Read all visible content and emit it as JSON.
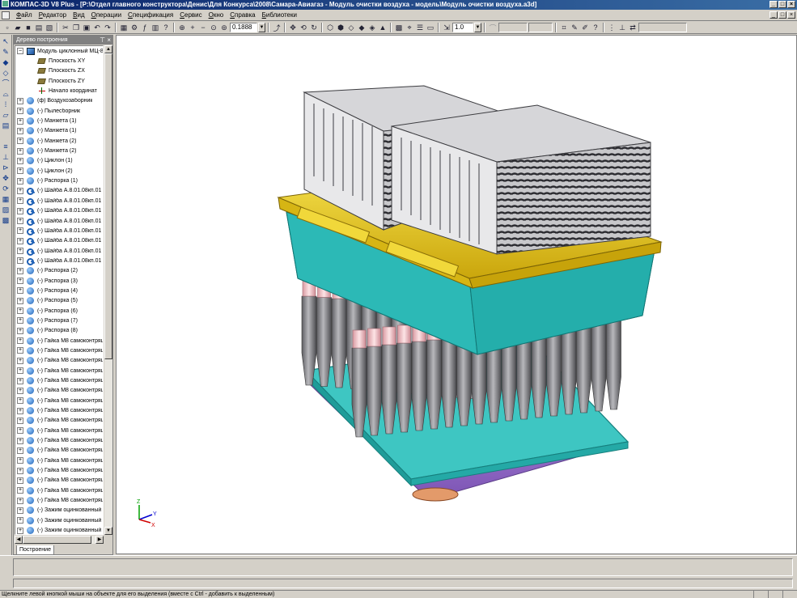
{
  "window": {
    "title": "КОМПАС-3D V8 Plus - [P:\\Отдел главного конструктора\\Денис\\Для Конкурса\\2008\\Самара-Авиагаз - Модуль очистки воздуха - модель\\Модуль очистки воздуха.a3d]"
  },
  "menu": {
    "items": [
      "Файл",
      "Редактор",
      "Вид",
      "Операции",
      "Спецификация",
      "Сервис",
      "Окно",
      "Справка",
      "Библиотеки"
    ]
  },
  "toolbar": {
    "zoom_value": "0.1888",
    "step_value": "1.0"
  },
  "panel": {
    "title": "Дерево построения",
    "tab_label": "Построение"
  },
  "tree": {
    "root": "Модуль циклонный МЦ-88",
    "items": [
      {
        "icon": "plane",
        "indent": 1,
        "label": "Плоскость XY"
      },
      {
        "icon": "plane",
        "indent": 1,
        "label": "Плоскость ZX"
      },
      {
        "icon": "plane",
        "indent": 1,
        "label": "Плоскость ZY"
      },
      {
        "icon": "origin",
        "indent": 1,
        "label": "Начало координат"
      },
      {
        "icon": "part",
        "expander": true,
        "label": "(ф) Воздухозаборник"
      },
      {
        "icon": "part",
        "expander": true,
        "label": "(-) Пылесборник"
      },
      {
        "icon": "part",
        "expander": true,
        "label": "(-) Манжета (1)"
      },
      {
        "icon": "part",
        "expander": true,
        "label": "(-) Манжета (1)"
      },
      {
        "icon": "part",
        "expander": true,
        "label": "(-) Манжета (2)"
      },
      {
        "icon": "part",
        "expander": true,
        "label": "(-) Манжета (2)"
      },
      {
        "icon": "part",
        "expander": true,
        "label": "(-) Циклон (1)"
      },
      {
        "icon": "part",
        "expander": true,
        "label": "(-) Циклон (2)"
      },
      {
        "icon": "part",
        "expander": true,
        "label": "(-) Распорка (1)"
      },
      {
        "icon": "key",
        "expander": true,
        "label": "(-) Шайба А.8.01.08кп.01"
      },
      {
        "icon": "key",
        "expander": true,
        "label": "(-) Шайба А.8.01.08кп.01"
      },
      {
        "icon": "key",
        "expander": true,
        "label": "(-) Шайба А.8.01.08кп.01"
      },
      {
        "icon": "key",
        "expander": true,
        "label": "(-) Шайба А.8.01.08кп.01"
      },
      {
        "icon": "key",
        "expander": true,
        "label": "(-) Шайба А.8.01.08кп.01"
      },
      {
        "icon": "key",
        "expander": true,
        "label": "(-) Шайба А.8.01.08кп.01"
      },
      {
        "icon": "key",
        "expander": true,
        "label": "(-) Шайба А.8.01.08кп.01"
      },
      {
        "icon": "key",
        "expander": true,
        "label": "(-) Шайба А.8.01.08кп.01"
      },
      {
        "icon": "part",
        "expander": true,
        "label": "(-) Распорка (2)"
      },
      {
        "icon": "part",
        "expander": true,
        "label": "(-) Распорка (3)"
      },
      {
        "icon": "part",
        "expander": true,
        "label": "(-) Распорка (4)"
      },
      {
        "icon": "part",
        "expander": true,
        "label": "(-) Распорка (5)"
      },
      {
        "icon": "part",
        "expander": true,
        "label": "(-) Распорка (6)"
      },
      {
        "icon": "part",
        "expander": true,
        "label": "(-) Распорка (7)"
      },
      {
        "icon": "part",
        "expander": true,
        "label": "(-) Распорка (8)"
      },
      {
        "icon": "part",
        "expander": true,
        "label": "(-) Гайка М8 самоконтрящ"
      },
      {
        "icon": "part",
        "expander": true,
        "label": "(-) Гайка М8 самоконтрящ"
      },
      {
        "icon": "part",
        "expander": true,
        "label": "(-) Гайка М8 самоконтрящ"
      },
      {
        "icon": "part",
        "expander": true,
        "label": "(-) Гайка М8 самоконтрящ"
      },
      {
        "icon": "part",
        "expander": true,
        "label": "(-) Гайка М8 самоконтрящ"
      },
      {
        "icon": "part",
        "expander": true,
        "label": "(-) Гайка М8 самоконтрящ"
      },
      {
        "icon": "part",
        "expander": true,
        "label": "(-) Гайка М8 самоконтрящ"
      },
      {
        "icon": "part",
        "expander": true,
        "label": "(-) Гайка М8 самоконтрящ"
      },
      {
        "icon": "part",
        "expander": true,
        "label": "(-) Гайка М8 самоконтрящ"
      },
      {
        "icon": "part",
        "expander": true,
        "label": "(-) Гайка М8 самоконтрящ"
      },
      {
        "icon": "part",
        "expander": true,
        "label": "(-) Гайка М8 самоконтрящ"
      },
      {
        "icon": "part",
        "expander": true,
        "label": "(-) Гайка М8 самоконтрящ"
      },
      {
        "icon": "part",
        "expander": true,
        "label": "(-) Гайка М8 самоконтрящ"
      },
      {
        "icon": "part",
        "expander": true,
        "label": "(-) Гайка М8 самоконтрящ"
      },
      {
        "icon": "part",
        "expander": true,
        "label": "(-) Гайка М8 самоконтрящ"
      },
      {
        "icon": "part",
        "expander": true,
        "label": "(-) Гайка М8 самоконтрящ"
      },
      {
        "icon": "part",
        "expander": true,
        "label": "(-) Гайка М8 самоконтрящ"
      },
      {
        "icon": "part",
        "expander": true,
        "label": "(-) Зажим оцинкованный"
      },
      {
        "icon": "part",
        "expander": true,
        "label": "(-) Зажим оцинкованный"
      },
      {
        "icon": "part",
        "expander": true,
        "label": "(-) Зажим оцинкованный"
      },
      {
        "icon": "part",
        "expander": true,
        "label": "(-) Зажим оцинкованный"
      }
    ]
  },
  "axes": {
    "x": "X",
    "y": "Y",
    "z": "Z"
  },
  "status": {
    "text": "Щелкните левой кнопкой мыши на объекте для его выделения (вместе с Ctrl - добавить к выделенным)"
  },
  "colors": {
    "filter_housing": "#e8e8ea",
    "yellow_frame": "#f2d21a",
    "cyan_body": "#34c7c4",
    "cyclone_gray": "#8a8a8e",
    "pink_sleeve": "#f7c8cc",
    "purple_hopper": "#a57ad6",
    "orange_outlet": "#e39a6a"
  }
}
